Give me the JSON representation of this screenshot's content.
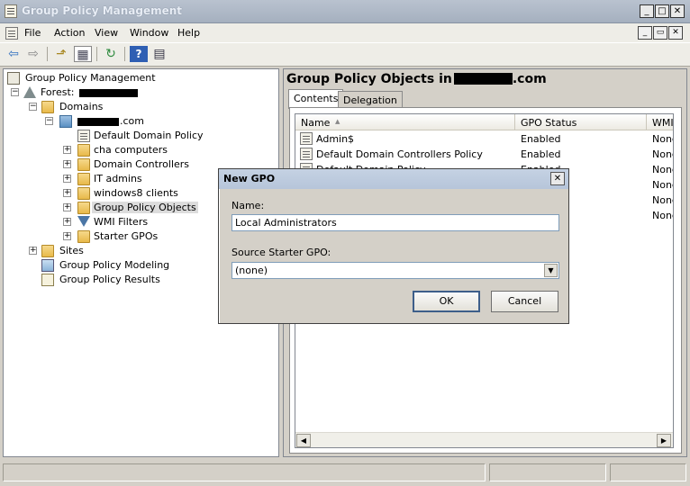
{
  "window": {
    "title": "Group Policy Management",
    "caption_minimize": "_",
    "caption_maximize": "□",
    "caption_close": "✕",
    "mdi_minimize": "_",
    "mdi_restore": "▭",
    "mdi_close": "✕"
  },
  "menu": {
    "items": [
      {
        "label": "File"
      },
      {
        "label": "Action"
      },
      {
        "label": "View"
      },
      {
        "label": "Window"
      },
      {
        "label": "Help"
      }
    ]
  },
  "toolbar": {
    "icons": [
      "back-arrow-icon",
      "forward-arrow-icon",
      "up-folder-icon",
      "show-hide-console-tree-icon",
      "refresh-icon",
      "help-icon",
      "properties-icon"
    ],
    "glyphs": {
      "back": "⇦",
      "forward": "⇨",
      "up": "⬏",
      "console": "▦",
      "refresh": "↻",
      "help": "?",
      "props": "▤"
    }
  },
  "tree": {
    "root": "Group Policy Management",
    "forest_prefix": "Forest:",
    "domains": "Domains",
    "domain_suffix": ".com",
    "items": [
      {
        "label": "Default Domain Policy"
      },
      {
        "label": "cha computers"
      },
      {
        "label": "Domain Controllers"
      },
      {
        "label": "IT admins"
      },
      {
        "label": "windows8 clients"
      },
      {
        "label": "Group Policy Objects"
      },
      {
        "label": "WMI Filters"
      },
      {
        "label": "Starter GPOs"
      }
    ],
    "sites": "Sites",
    "modeling": "Group Policy Modeling",
    "results": "Group Policy Results",
    "plus": "+",
    "minus": "−"
  },
  "right_pane": {
    "title_prefix": "Group Policy Objects in",
    "title_suffix": ".com",
    "tabs": [
      {
        "label": "Contents"
      },
      {
        "label": "Delegation"
      }
    ],
    "columns": [
      {
        "label": "Name"
      },
      {
        "label": "GPO Status"
      },
      {
        "label": "WMI"
      }
    ],
    "sort_glyph": "▲",
    "rows": [
      {
        "name": "Admin$",
        "status": "Enabled",
        "wmi": "None"
      },
      {
        "name": "Default Domain Controllers Policy",
        "status": "Enabled",
        "wmi": "None"
      },
      {
        "name": "Default Domain Policy",
        "status": "Enabled",
        "wmi": "None"
      },
      {
        "name": "",
        "status": "",
        "wmi": "None"
      },
      {
        "name": "",
        "status": "",
        "wmi": "None"
      },
      {
        "name": "",
        "status": "",
        "wmi": "None"
      }
    ],
    "scroll_left": "◀",
    "scroll_right": "▶"
  },
  "dialog": {
    "title": "New GPO",
    "close": "✕",
    "name_label": "Name:",
    "name_value": "Local Administrators",
    "starter_label": "Source Starter GPO:",
    "starter_value": "(none)",
    "dropdown_glyph": "▼",
    "ok_label": "OK",
    "cancel_label": "Cancel"
  }
}
